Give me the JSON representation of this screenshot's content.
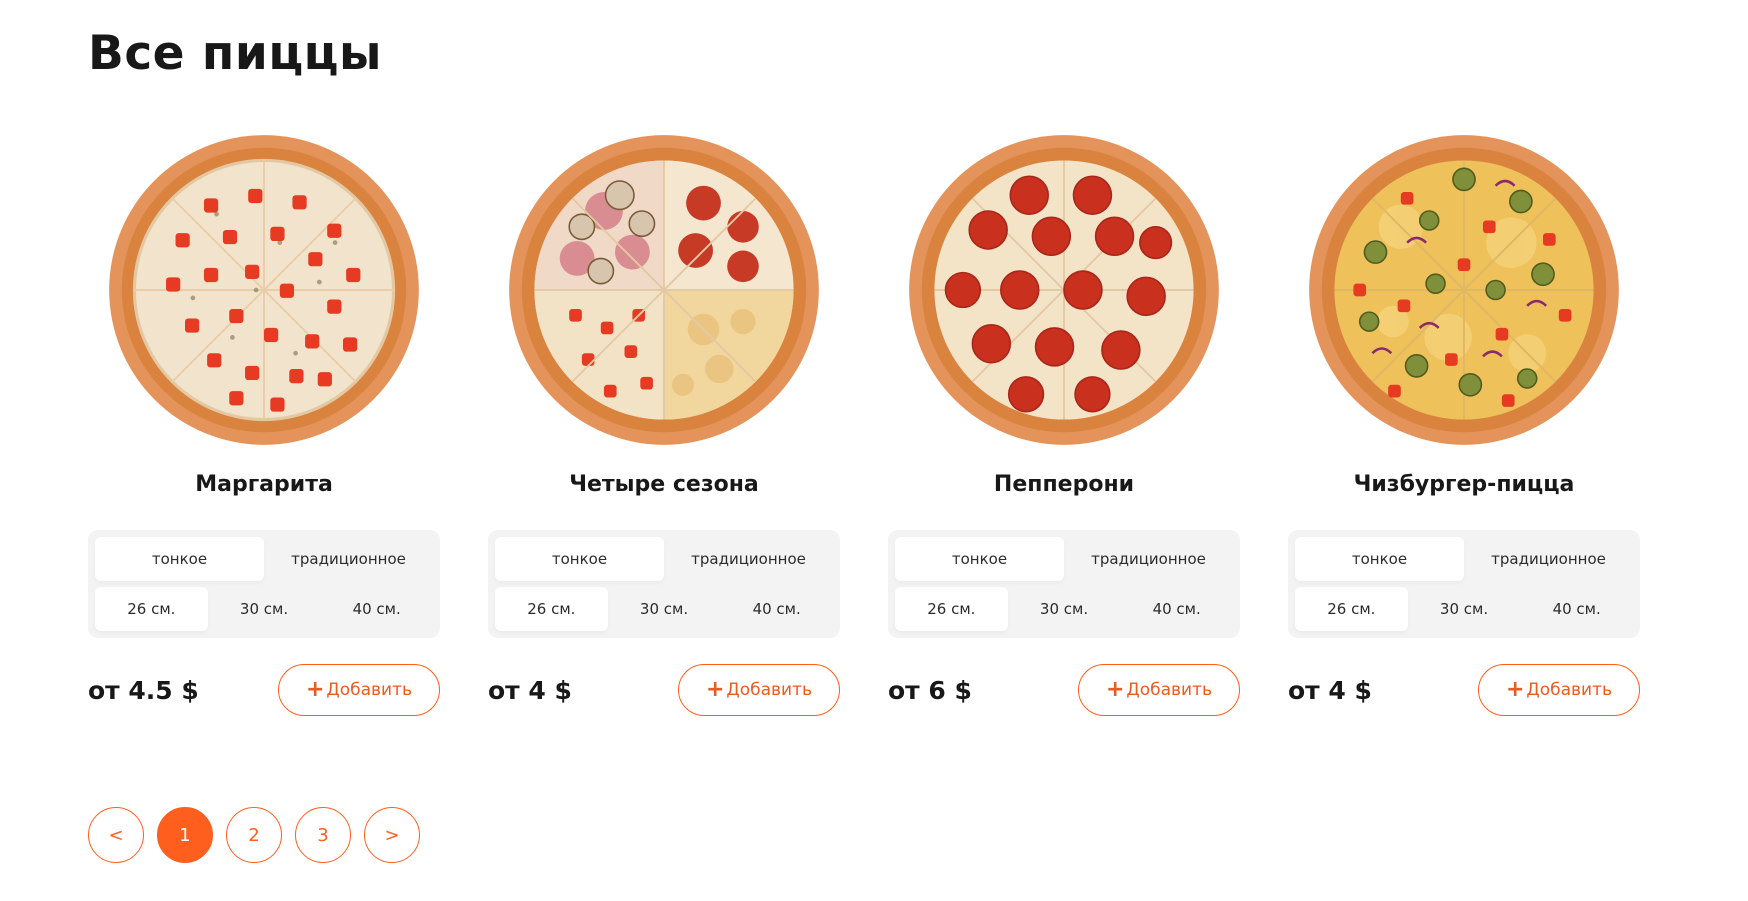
{
  "heading": "Все пиццы",
  "labels": {
    "price_prefix": "от",
    "currency": "$",
    "add_plus": "+",
    "add_label": "Добавить"
  },
  "pizzas": [
    {
      "name": "Маргарита",
      "price": "от 4.5 $",
      "dough_types": [
        "тонкое",
        "традиционное"
      ],
      "sizes": [
        "26 см.",
        "30 см.",
        "40 см."
      ],
      "selected_dough": 0,
      "selected_size": 0,
      "image": "margarita-pizza-image"
    },
    {
      "name": "Четыре сезона",
      "price": "от 4 $",
      "dough_types": [
        "тонкое",
        "традиционное"
      ],
      "sizes": [
        "26 см.",
        "30 см.",
        "40 см."
      ],
      "selected_dough": 0,
      "selected_size": 0,
      "image": "four-seasons-pizza-image"
    },
    {
      "name": "Пепперони",
      "price": "от 6 $",
      "dough_types": [
        "тонкое",
        "традиционное"
      ],
      "sizes": [
        "26 см.",
        "30 см.",
        "40 см."
      ],
      "selected_dough": 0,
      "selected_size": 0,
      "image": "pepperoni-pizza-image"
    },
    {
      "name": "Чизбургер-пицца",
      "price": "от 4 $",
      "dough_types": [
        "тонкое",
        "традиционное"
      ],
      "sizes": [
        "26 см.",
        "30 см.",
        "40 см."
      ],
      "selected_dough": 0,
      "selected_size": 0,
      "image": "cheeseburger-pizza-image"
    }
  ],
  "pagination": {
    "prev": "<",
    "pages": [
      "1",
      "2",
      "3"
    ],
    "current": "1",
    "next": ">"
  },
  "colors": {
    "accent": "#fe5f1e",
    "text": "#181818",
    "selector_bg": "#f3f3f3"
  }
}
